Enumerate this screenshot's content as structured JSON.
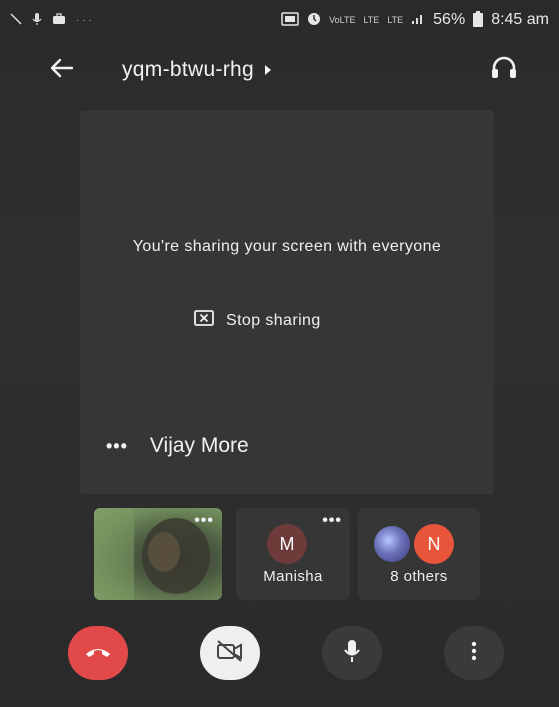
{
  "status_bar": {
    "battery_percent": "56%",
    "time": "8:45 am",
    "network_label_1": "LTE",
    "network_label_2": "LTE",
    "volte": "VoLTE"
  },
  "app_bar": {
    "meeting_code": "yqm-btwu-rhg",
    "back_icon": "arrow-left-icon",
    "audio_icon": "headset-icon",
    "expand_icon": "caret-right-icon"
  },
  "stage": {
    "share_message": "You're sharing your screen with everyone",
    "stop_label": "Stop sharing",
    "stop_icon": "stop-share-icon",
    "presenter_name": "Vijay More",
    "presenter_menu": "•••"
  },
  "participants": [
    {
      "type": "video",
      "menu": "•••"
    },
    {
      "type": "avatar",
      "initial": "M",
      "name": "Manisha",
      "menu": "•••",
      "color": "#6e3a3a"
    },
    {
      "type": "group",
      "initial": "N",
      "name": "8 others",
      "color": "#e8553a"
    }
  ],
  "controls": {
    "end_call_icon": "phone-hangup-icon",
    "end_call_color": "#e24a4a",
    "camera_icon": "camera-off-icon",
    "mic_icon": "microphone-icon",
    "more_icon": "more-vertical-icon"
  }
}
